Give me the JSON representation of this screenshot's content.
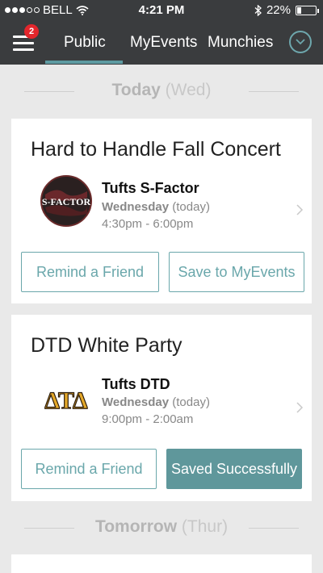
{
  "status_bar": {
    "carrier": "BELL",
    "time": "4:21 PM",
    "battery": "22%",
    "battery_level": 0.22
  },
  "nav": {
    "badge_count": "2",
    "tabs": [
      {
        "label": "Public",
        "active": true
      },
      {
        "label": "MyEvents",
        "active": false
      },
      {
        "label": "Munchies",
        "active": false
      }
    ]
  },
  "sections": [
    {
      "day": "Today",
      "dow": "(Wed)"
    },
    {
      "day": "Tomorrow",
      "dow": "(Thur)"
    }
  ],
  "events": [
    {
      "title": "Hard to Handle Fall Concert",
      "org": "Tufts S-Factor",
      "logo_text": "S-FACTOR",
      "day": "Wednesday",
      "day_note": "(today)",
      "time": "4:30pm - 6:00pm",
      "remind_label": "Remind a Friend",
      "save_label": "Save to MyEvents",
      "saved": false
    },
    {
      "title": "DTD White Party",
      "org": "Tufts DTD",
      "logo_text": "ΔΤΔ",
      "day": "Wednesday",
      "day_note": "(today)",
      "time": "9:00pm - 2:00am",
      "remind_label": "Remind a Friend",
      "save_label": "Saved Successfully",
      "saved": true
    }
  ],
  "colors": {
    "bar_bg": "#3a3c3e",
    "accent": "#5f979b",
    "badge": "#e3262c",
    "page_bg": "#e9e9e9"
  }
}
